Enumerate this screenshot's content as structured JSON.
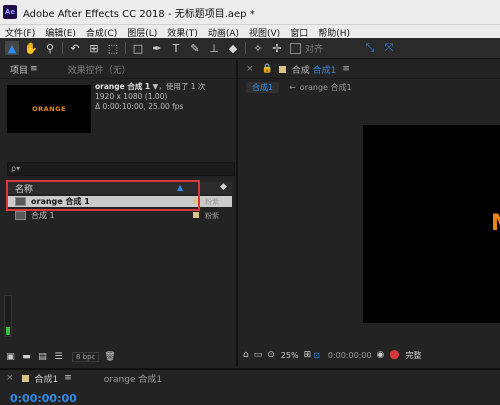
{
  "window": {
    "app_badge": "Ae",
    "title": "Adobe After Effects CC 2018 - 无标题项目.aep *"
  },
  "menu": [
    "文件(F)",
    "编辑(E)",
    "合成(C)",
    "图层(L)",
    "效果(T)",
    "动画(A)",
    "视图(V)",
    "窗口",
    "帮助(H)"
  ],
  "toolbar": {
    "snap_label": "对齐"
  },
  "project": {
    "tab_project": "项目",
    "tab_effects": "效果控件（无）",
    "thumbnail_text": "ORANGE",
    "info": {
      "name": "orange 合成 1",
      "used": "▼，使用了 1 次",
      "dims": "1920 x 1080 (1.00)",
      "duration": "Δ 0:00:10:00, 25.00 fps"
    },
    "search_placeholder": "ρ▾",
    "col_name": "名称",
    "items": [
      {
        "name": "orange 合成 1",
        "label": "粉紫"
      },
      {
        "name": "合成 1",
        "label": "粉紫"
      }
    ],
    "bpc": "8 bpc"
  },
  "composition": {
    "tab_prefix": "合成",
    "tab_name": "合成1",
    "crumb_active": "合成1",
    "crumb_other": "orange 合成1",
    "viewer_text": "M",
    "zoom": "25%",
    "timecode": "0:00:00:00",
    "resolution": "完整"
  },
  "timeline": {
    "tab": "合成1",
    "tab2": "orange 合成1",
    "timecode": "0:00:00:00"
  },
  "colors": {
    "accent": "#2d8ceb",
    "highlight": "#d9383a",
    "orange": "#e8891a",
    "label": "#d8c38a"
  }
}
